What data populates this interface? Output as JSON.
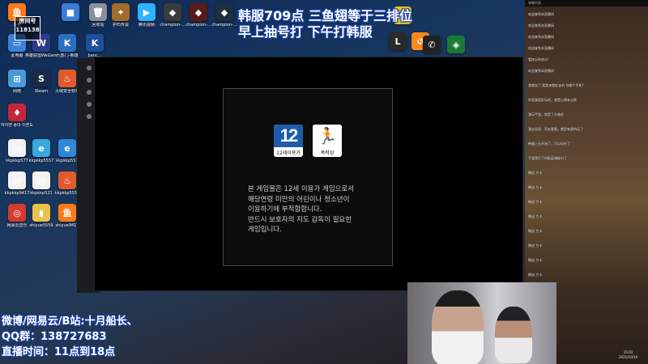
{
  "desktop": {
    "icons": [
      {
        "label": "斗鱼",
        "color": "#ff7a1a",
        "glyph": "鱼"
      },
      {
        "label": "",
        "color": "#3a7bd5",
        "glyph": "■"
      },
      {
        "label": "回收站",
        "color": "#8a8f99",
        "glyph": "🗑"
      },
      {
        "label": "护石传说",
        "color": "#a36b2a",
        "glyph": "✦"
      },
      {
        "label": "腾讯视频",
        "color": "#2fb2ff",
        "glyph": "▶"
      },
      {
        "label": "champion-...",
        "color": "#3b3b3b",
        "glyph": "◆"
      },
      {
        "label": "champion-...",
        "color": "#5a1a1a",
        "glyph": "◆"
      },
      {
        "label": "champion-...",
        "color": "#1f2f3f",
        "glyph": "◆"
      },
      {
        "label": "此电脑",
        "color": "#3a82d8",
        "glyph": "▭"
      },
      {
        "label": "英雄联盟WeGame版",
        "color": "#2d3b8a",
        "glyph": "W"
      },
      {
        "label": "九部门-英雄",
        "color": "#2b6fc0",
        "glyph": "K"
      },
      {
        "label": "banc...",
        "color": "#1f4f9a",
        "glyph": "K"
      },
      {
        "label": "网络",
        "color": "#4a9ad8",
        "glyph": "⊞"
      },
      {
        "label": "Steam",
        "color": "#1b2a47",
        "glyph": "S"
      },
      {
        "label": "火绒安全软件",
        "color": "#e05a2b",
        "glyph": "♨"
      },
      {
        "label": "하이앤 종마 이혼도",
        "color": "#c2273b",
        "glyph": "♦"
      },
      {
        "label": "kkpkkp577",
        "color": "#f2f2f2",
        "glyph": "▤"
      },
      {
        "label": "kkpkkp5557",
        "color": "#3aa7e0",
        "glyph": "e"
      },
      {
        "label": "kkpkkp557",
        "color": "#2f88d8",
        "glyph": "e"
      },
      {
        "label": "kkpkkp9417",
        "color": "#f2f2f2",
        "glyph": "▤"
      },
      {
        "label": "kkpkkp521",
        "color": "#f2f2f2",
        "glyph": "▤"
      },
      {
        "label": "kkpkkp5559",
        "color": "#e05a2b",
        "glyph": "♨"
      },
      {
        "label": "网易云音乐",
        "color": "#d33a31",
        "glyph": "◎"
      },
      {
        "label": "shiyue5559",
        "color": "#e8c24a",
        "glyph": "▮"
      },
      {
        "label": "shiyue9417",
        "color": "#ff7a1a",
        "glyph": "鱼"
      }
    ],
    "top_row_right_icons": [
      {
        "label": "",
        "color": "#2a2a2a",
        "glyph": "L"
      },
      {
        "label": "",
        "color": "#ff8a1a",
        "glyph": "↺"
      },
      {
        "label": "",
        "color": "#e8c71a",
        "glyph": "◉"
      },
      {
        "label": "",
        "color": "#222",
        "glyph": "✆"
      },
      {
        "label": "",
        "color": "#1b7a3a",
        "glyph": "◈"
      }
    ],
    "room_badge": {
      "line1": "房间号",
      "line2": "118138"
    }
  },
  "game_notice": {
    "age_badge_number": "12",
    "age_badge_caption": "12세이용가",
    "violence_badge_caption": "폭력성",
    "lines": [
      "본 게임물은 12세 이용가 게임으로서",
      "해당연령 미만의 어린이나 청소년이",
      "이용하기에 부적합합니다.",
      "반드시 보호자의 지도 감독이 필요한",
      "게임입니다."
    ]
  },
  "overlay": {
    "top_line1": "韩服709点  三鱼翅等于三排位",
    "top_line2": "早上抽号打 下午打韩服",
    "info_lines": [
      "微博/网易云/B站:十月船长、",
      "QQ群：138727683",
      "直播时间：11点到18点"
    ]
  },
  "chat": {
    "header": "弹幕列表",
    "rows": [
      {
        "tag": "",
        "nick": "",
        "text": "欢迎来到本直播间"
      },
      {
        "tag": "",
        "nick": "",
        "text": "欢迎来到本直播间"
      },
      {
        "tag": "",
        "nick": "",
        "text": "欢迎来到本直播间"
      },
      {
        "tag": "",
        "nick": "",
        "text": "欢迎来到本直播间"
      },
      {
        "tag": "",
        "nick": "",
        "text": "看快乐的欢乐!"
      },
      {
        "tag": "",
        "nick": "",
        "text": "欢迎来到本直播间"
      },
      {
        "tag": "",
        "nick": "",
        "text": "我就说了,我是来看船长的 你哪个手机?"
      },
      {
        "tag": "",
        "nick": "",
        "text": "你是真挺好玩的，就是心情有点差"
      },
      {
        "tag": "",
        "nick": "",
        "text": "我玩手游，就是了头像很"
      },
      {
        "tag": "",
        "nick": "",
        "text": "我这局里，再去看看，就是有我的玩了"
      },
      {
        "tag": "",
        "nick": "",
        "text": "韩服上分开始了，可以玩吗了"
      },
      {
        "tag": "",
        "nick": "",
        "text": "手游我打了吗配英魂碰对了"
      },
      {
        "tag": "",
        "nick": "",
        "text": "赠送 力卡"
      },
      {
        "tag": "",
        "nick": "",
        "text": "赠送 力卡"
      },
      {
        "tag": "",
        "nick": "",
        "text": "赠送 力卡"
      },
      {
        "tag": "",
        "nick": "",
        "text": "赠送 力卡"
      },
      {
        "tag": "",
        "nick": "",
        "text": "赠送 力卡"
      },
      {
        "tag": "",
        "nick": "",
        "text": "赠送 力卡"
      },
      {
        "tag": "",
        "nick": "",
        "text": "赠送 力卡"
      },
      {
        "tag": "",
        "nick": "",
        "text": "赠送 力卡"
      }
    ]
  },
  "clock": {
    "time": "15:01",
    "date": "2021/10/14"
  }
}
